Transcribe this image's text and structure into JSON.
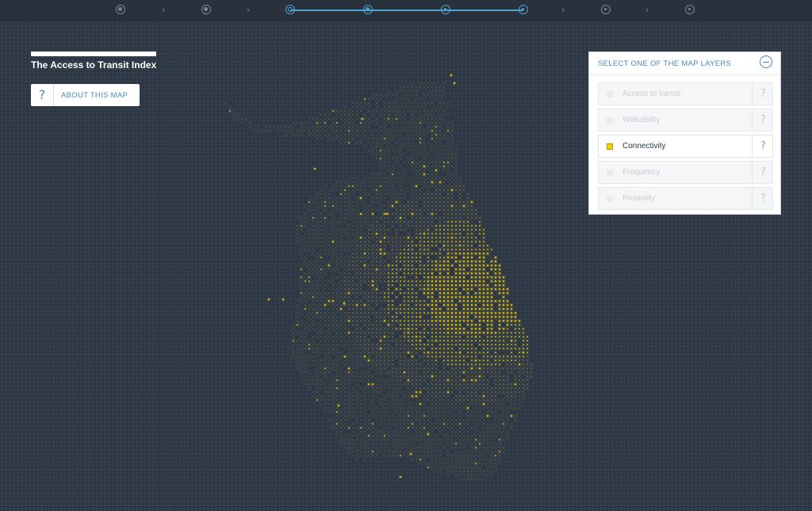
{
  "header": {
    "title": "The Access to Transit Index",
    "about_label": "ABOUT THIS MAP",
    "about_icon": "?"
  },
  "stepper": {
    "steps": [
      "step-1",
      "step-2",
      "step-3",
      "step-4",
      "step-5",
      "step-6",
      "step-7",
      "step-8",
      "step-9"
    ],
    "active_range": [
      3,
      6
    ],
    "chevron_glyph": "›"
  },
  "layer_panel": {
    "title": "SELECT ONE OF THE MAP LAYERS",
    "layers": [
      {
        "label": "Access to transit",
        "selected": false,
        "help": "?"
      },
      {
        "label": "Walkability",
        "selected": false,
        "help": "?"
      },
      {
        "label": "Connectivity",
        "selected": true,
        "help": "?"
      },
      {
        "label": "Frequency",
        "selected": false,
        "help": "?"
      },
      {
        "label": "Proximity",
        "selected": false,
        "help": "?"
      }
    ]
  },
  "colors": {
    "background": "#2e3744",
    "grid_dot": "#3e4754",
    "low_value": "#7a7a3c",
    "high_value": "#f5d000",
    "accent": "#4fa3d1",
    "link_text": "#4a89b8"
  },
  "icons": {
    "collapse": "minus-circle-icon",
    "help": "question-icon",
    "step_chevron": "chevron-right-icon"
  }
}
